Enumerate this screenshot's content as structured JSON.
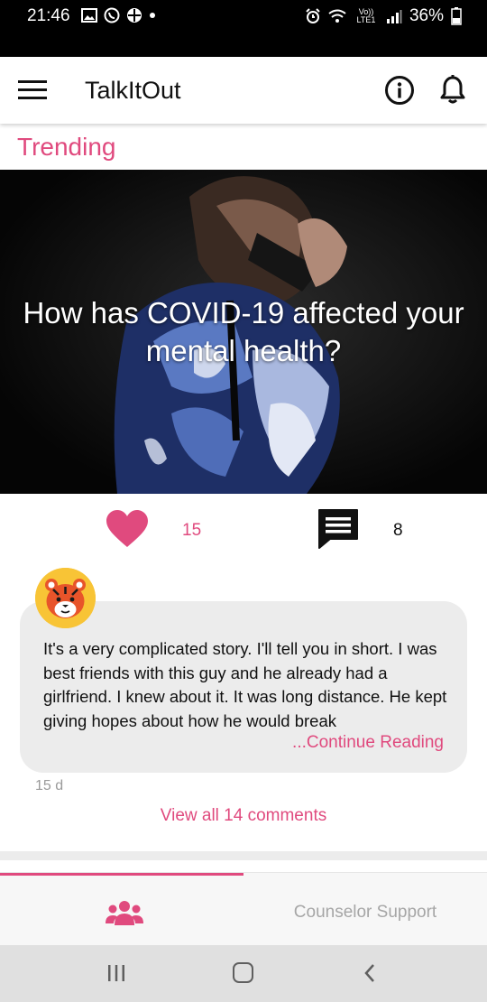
{
  "status_bar": {
    "time": "21:46",
    "network": "Vo)) LTE1",
    "battery": "36%",
    "icons": [
      "gallery-icon",
      "whatsapp-icon",
      "app-icon",
      "dot-icon",
      "alarm-icon",
      "wifi-icon",
      "signal-icon",
      "battery-icon"
    ]
  },
  "app_bar": {
    "title": "TalkItOut",
    "icons": [
      "menu-icon",
      "info-icon",
      "bell-icon"
    ]
  },
  "section": {
    "title": "Trending"
  },
  "post": {
    "question": "How has COVID-19 affected your mental health?",
    "likes": "15",
    "comments": "8",
    "icons": [
      "heart-icon",
      "comment-icon"
    ]
  },
  "comment": {
    "text": "It's a very complicated story. I'll tell you in short. I was best friends with this guy and he already had a girlfriend. I knew about it. It was long distance. He kept giving hopes about how he would break",
    "continue_label": "...Continue Reading",
    "age": "15 d",
    "avatar_icon": "tiger-avatar-icon"
  },
  "view_all_label": "View all 14 comments",
  "tabs": {
    "community_icon": "users-icon",
    "counselor_label": "Counselor Support",
    "active": "community"
  },
  "nav_bar": {
    "icons": [
      "recent-apps-icon",
      "home-icon",
      "back-icon"
    ]
  },
  "colors": {
    "accent": "#e04a7e",
    "avatar_bg": "#f8c436",
    "bubble": "#ececec"
  }
}
